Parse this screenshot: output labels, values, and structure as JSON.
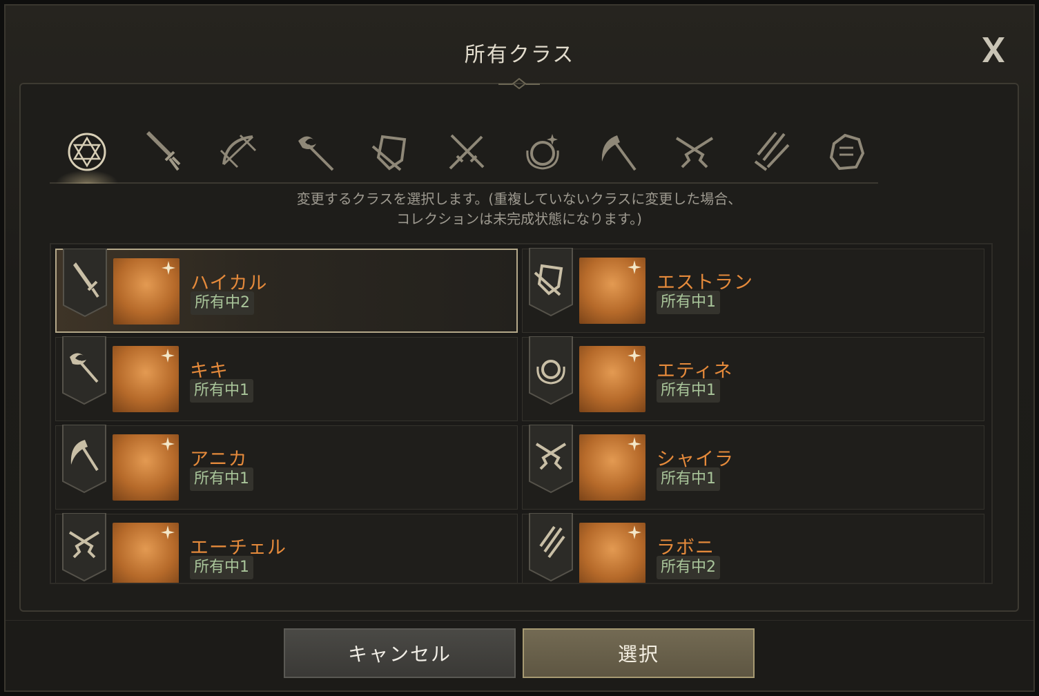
{
  "dialog": {
    "title": "所有クラス",
    "notice_line1": "変更するクラスを選択します。(重複していないクラスに変更した場合、",
    "notice_line2": "コレクションは未完成状態になります。)"
  },
  "tabs": [
    {
      "icon": "hexagram-icon",
      "active": true
    },
    {
      "icon": "sword-icon",
      "active": false
    },
    {
      "icon": "crossbow-icon",
      "active": false
    },
    {
      "icon": "staff-icon",
      "active": false
    },
    {
      "icon": "shield-sword-icon",
      "active": false
    },
    {
      "icon": "crossed-daggers-icon",
      "active": false
    },
    {
      "icon": "orb-icon",
      "active": false
    },
    {
      "icon": "scythe-icon",
      "active": false
    },
    {
      "icon": "crossed-pistols-icon",
      "active": false
    },
    {
      "icon": "claw-blade-icon",
      "active": false
    },
    {
      "icon": "gauntlet-icon",
      "active": false
    }
  ],
  "classes": [
    {
      "name": "ハイカル",
      "count": "所有中2",
      "icon": "sword-icon",
      "selected": true
    },
    {
      "name": "エストラン",
      "count": "所有中1",
      "icon": "shield-sword-icon",
      "selected": false
    },
    {
      "name": "キキ",
      "count": "所有中1",
      "icon": "staff-icon",
      "selected": false
    },
    {
      "name": "エティネ",
      "count": "所有中1",
      "icon": "orb-icon",
      "selected": false
    },
    {
      "name": "アニカ",
      "count": "所有中1",
      "icon": "scythe-icon",
      "selected": false
    },
    {
      "name": "シャイラ",
      "count": "所有中1",
      "icon": "crossed-pistols-icon",
      "selected": false
    },
    {
      "name": "エーチェル",
      "count": "所有中1",
      "icon": "crossed-pistols-icon",
      "selected": false
    },
    {
      "name": "ラボニ",
      "count": "所有中2",
      "icon": "claw-blade-icon",
      "selected": false
    }
  ],
  "buttons": {
    "cancel_label": "キャンセル",
    "select_label": "選択"
  },
  "colors": {
    "name_orange": "#e58a3b",
    "count_green": "#a9c59a",
    "icon_gold": "#c9bfa6"
  }
}
